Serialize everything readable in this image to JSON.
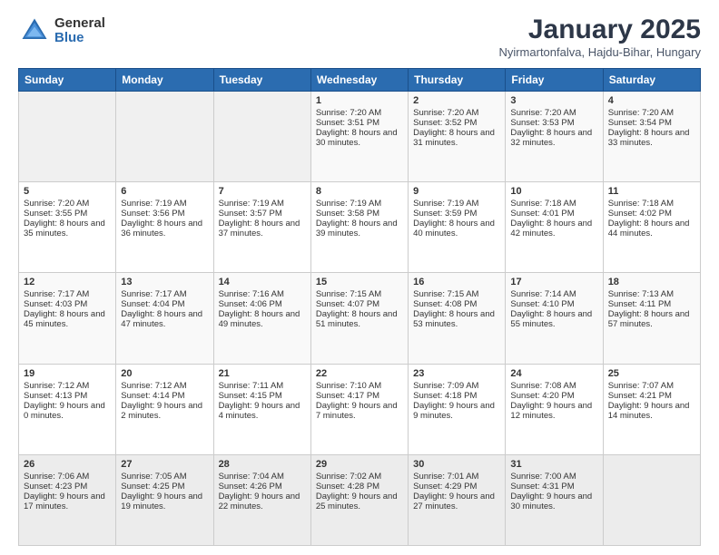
{
  "logo": {
    "general": "General",
    "blue": "Blue"
  },
  "header": {
    "month": "January 2025",
    "location": "Nyirmartonfalva, Hajdu-Bihar, Hungary"
  },
  "days_of_week": [
    "Sunday",
    "Monday",
    "Tuesday",
    "Wednesday",
    "Thursday",
    "Friday",
    "Saturday"
  ],
  "weeks": [
    [
      {
        "day": "",
        "data": ""
      },
      {
        "day": "",
        "data": ""
      },
      {
        "day": "",
        "data": ""
      },
      {
        "day": "1",
        "sunrise": "7:20 AM",
        "sunset": "3:51 PM",
        "daylight": "8 hours and 30 minutes."
      },
      {
        "day": "2",
        "sunrise": "7:20 AM",
        "sunset": "3:52 PM",
        "daylight": "8 hours and 31 minutes."
      },
      {
        "day": "3",
        "sunrise": "7:20 AM",
        "sunset": "3:53 PM",
        "daylight": "8 hours and 32 minutes."
      },
      {
        "day": "4",
        "sunrise": "7:20 AM",
        "sunset": "3:54 PM",
        "daylight": "8 hours and 33 minutes."
      }
    ],
    [
      {
        "day": "5",
        "sunrise": "7:20 AM",
        "sunset": "3:55 PM",
        "daylight": "8 hours and 35 minutes."
      },
      {
        "day": "6",
        "sunrise": "7:19 AM",
        "sunset": "3:56 PM",
        "daylight": "8 hours and 36 minutes."
      },
      {
        "day": "7",
        "sunrise": "7:19 AM",
        "sunset": "3:57 PM",
        "daylight": "8 hours and 37 minutes."
      },
      {
        "day": "8",
        "sunrise": "7:19 AM",
        "sunset": "3:58 PM",
        "daylight": "8 hours and 39 minutes."
      },
      {
        "day": "9",
        "sunrise": "7:19 AM",
        "sunset": "3:59 PM",
        "daylight": "8 hours and 40 minutes."
      },
      {
        "day": "10",
        "sunrise": "7:18 AM",
        "sunset": "4:01 PM",
        "daylight": "8 hours and 42 minutes."
      },
      {
        "day": "11",
        "sunrise": "7:18 AM",
        "sunset": "4:02 PM",
        "daylight": "8 hours and 44 minutes."
      }
    ],
    [
      {
        "day": "12",
        "sunrise": "7:17 AM",
        "sunset": "4:03 PM",
        "daylight": "8 hours and 45 minutes."
      },
      {
        "day": "13",
        "sunrise": "7:17 AM",
        "sunset": "4:04 PM",
        "daylight": "8 hours and 47 minutes."
      },
      {
        "day": "14",
        "sunrise": "7:16 AM",
        "sunset": "4:06 PM",
        "daylight": "8 hours and 49 minutes."
      },
      {
        "day": "15",
        "sunrise": "7:15 AM",
        "sunset": "4:07 PM",
        "daylight": "8 hours and 51 minutes."
      },
      {
        "day": "16",
        "sunrise": "7:15 AM",
        "sunset": "4:08 PM",
        "daylight": "8 hours and 53 minutes."
      },
      {
        "day": "17",
        "sunrise": "7:14 AM",
        "sunset": "4:10 PM",
        "daylight": "8 hours and 55 minutes."
      },
      {
        "day": "18",
        "sunrise": "7:13 AM",
        "sunset": "4:11 PM",
        "daylight": "8 hours and 57 minutes."
      }
    ],
    [
      {
        "day": "19",
        "sunrise": "7:12 AM",
        "sunset": "4:13 PM",
        "daylight": "9 hours and 0 minutes."
      },
      {
        "day": "20",
        "sunrise": "7:12 AM",
        "sunset": "4:14 PM",
        "daylight": "9 hours and 2 minutes."
      },
      {
        "day": "21",
        "sunrise": "7:11 AM",
        "sunset": "4:15 PM",
        "daylight": "9 hours and 4 minutes."
      },
      {
        "day": "22",
        "sunrise": "7:10 AM",
        "sunset": "4:17 PM",
        "daylight": "9 hours and 7 minutes."
      },
      {
        "day": "23",
        "sunrise": "7:09 AM",
        "sunset": "4:18 PM",
        "daylight": "9 hours and 9 minutes."
      },
      {
        "day": "24",
        "sunrise": "7:08 AM",
        "sunset": "4:20 PM",
        "daylight": "9 hours and 12 minutes."
      },
      {
        "day": "25",
        "sunrise": "7:07 AM",
        "sunset": "4:21 PM",
        "daylight": "9 hours and 14 minutes."
      }
    ],
    [
      {
        "day": "26",
        "sunrise": "7:06 AM",
        "sunset": "4:23 PM",
        "daylight": "9 hours and 17 minutes."
      },
      {
        "day": "27",
        "sunrise": "7:05 AM",
        "sunset": "4:25 PM",
        "daylight": "9 hours and 19 minutes."
      },
      {
        "day": "28",
        "sunrise": "7:04 AM",
        "sunset": "4:26 PM",
        "daylight": "9 hours and 22 minutes."
      },
      {
        "day": "29",
        "sunrise": "7:02 AM",
        "sunset": "4:28 PM",
        "daylight": "9 hours and 25 minutes."
      },
      {
        "day": "30",
        "sunrise": "7:01 AM",
        "sunset": "4:29 PM",
        "daylight": "9 hours and 27 minutes."
      },
      {
        "day": "31",
        "sunrise": "7:00 AM",
        "sunset": "4:31 PM",
        "daylight": "9 hours and 30 minutes."
      },
      {
        "day": "",
        "data": ""
      }
    ]
  ]
}
